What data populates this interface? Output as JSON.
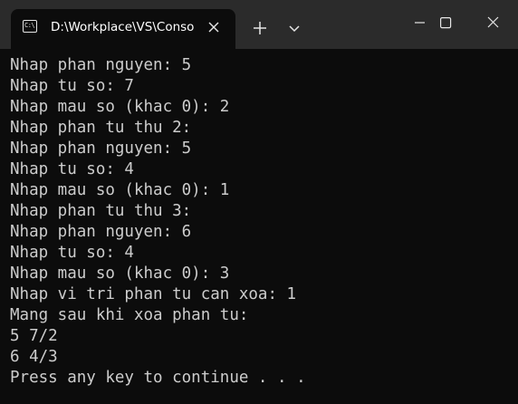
{
  "window": {
    "tab_title": "D:\\Workplace\\VS\\Console",
    "tab_icon": "terminal-icon",
    "tab_icon_text": "C:\\"
  },
  "controls": {
    "close_tab_icon": "close-icon",
    "new_tab_icon": "plus-icon",
    "dropdown_icon": "chevron-down-icon",
    "minimize_icon": "minimize-icon",
    "maximize_icon": "maximize-icon",
    "close_window_icon": "close-icon"
  },
  "console": {
    "lines": [
      "Nhap phan nguyen: 5",
      "Nhap tu so: 7",
      "Nhap mau so (khac 0): 2",
      "Nhap phan tu thu 2:",
      "Nhap phan nguyen: 5",
      "Nhap tu so: 4",
      "Nhap mau so (khac 0): 1",
      "Nhap phan tu thu 3:",
      "Nhap phan nguyen: 6",
      "Nhap tu so: 4",
      "Nhap mau so (khac 0): 3",
      "Nhap vi tri phan tu can xoa: 1",
      "Mang sau khi xoa phan tu:",
      "5 7/2",
      "6 4/3",
      "Press any key to continue . . ."
    ]
  },
  "colors": {
    "titlebar": "#2b2b2b",
    "console_bg": "#0c0c0c",
    "console_text": "#cccccc",
    "title_text": "#ffffff"
  }
}
